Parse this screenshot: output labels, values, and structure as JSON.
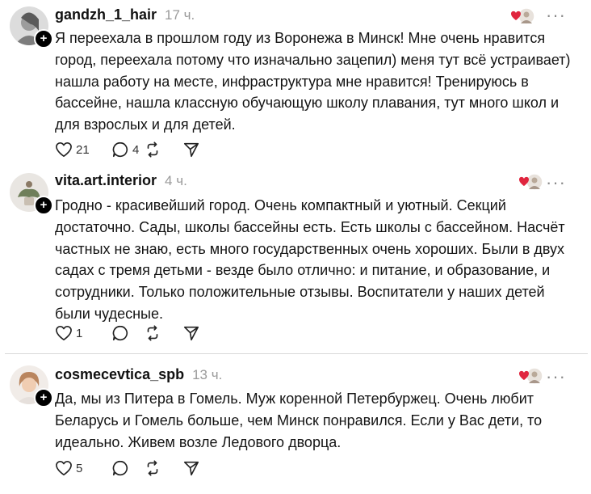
{
  "colors": {
    "heart_red": "#e0253e",
    "muted": "#9a9a9a",
    "divider": "#d9d9d9"
  },
  "comments": [
    {
      "username": "gandzh_1_hair",
      "time": "17 ч.",
      "lines": [
        "Я переехала в прошлом году из Воронежа в Минск! Мне очень нравится",
        "город, переехала потому что изначально зацепил) меня тут всё устраивает)",
        "нашла работу на месте, инфраструктура мне нравится! Тренируюсь в",
        "бассейне, нашла классную обучающую школу плавания, тут много школ и",
        "для взрослых и для детей."
      ],
      "likes": "21",
      "replies": "4",
      "more_icon": "ellipsis-icon"
    },
    {
      "username": "vita.art.interior",
      "time": "4 ч.",
      "lines": [
        "Гродно - красивейший город. Очень компактный и уютный. Секций",
        "достаточно. Сады, школы бассейны есть. Есть школы с бассейном. Насчёт",
        "частных не знаю, есть много государственных очень хороших. Были в двух",
        "садах с тремя детьми - везде было отлично: и питание, и образование, и",
        "сотрудники. Только положительные отзывы. Воспитатели у наших детей",
        "были чудесные."
      ],
      "likes": "1",
      "replies": "",
      "more_icon": "ellipsis-icon"
    },
    {
      "username": "cosmecevtica_spb",
      "time": "13 ч.",
      "lines": [
        "Да, мы из Питера в Гомель. Муж коренной Петербуржец. Очень любит",
        "Беларусь и Гомель больше, чем Минск понравился. Если у Вас дети, то",
        "идеально. Живем возле Ледового дворца."
      ],
      "likes": "5",
      "replies": "",
      "more_icon": "ellipsis-icon"
    }
  ]
}
